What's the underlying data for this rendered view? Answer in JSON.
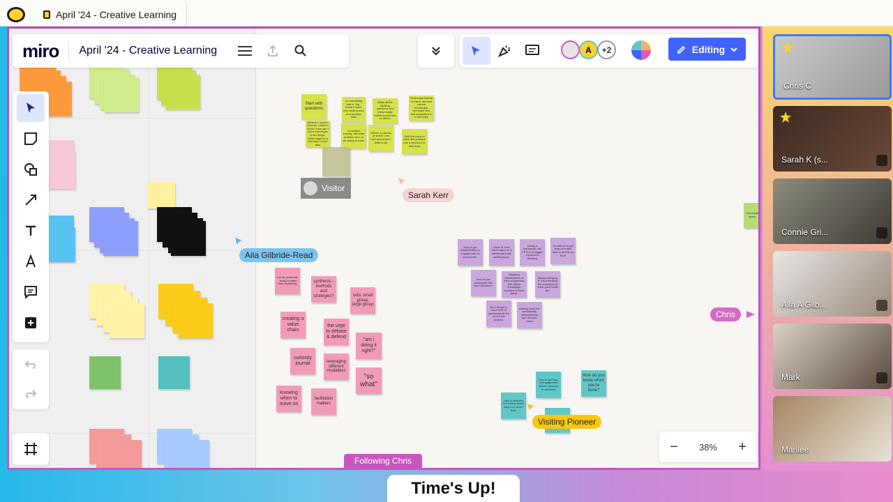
{
  "window": {
    "tab_title": "April '24 - Creative Learning"
  },
  "header": {
    "logo": "miro",
    "board_title": "April '24 - Creative Learning"
  },
  "collab": {
    "avatar_initial": "A",
    "more_count": "+2",
    "editing_label": "Editing"
  },
  "cursors": {
    "sarah": "Sarah Kerr",
    "aila": "Aila Gilbride-Read",
    "chris": "Chris",
    "visitor": "Visitor",
    "visiting_pioneer": "Visiting Pioneer"
  },
  "notes": {
    "yellow": [
      "Start with questions",
      "It's everything that is \"big\", break it down into small pieces and practice each",
      "Make all the thinking questions and ideas easily visible to self and to others",
      "Draft experiments to frame and test current knowledge, threshold and skill acquisition in a new way",
      "What do I know? what do I want to know? How can I know that might, know things. What might be a first step I could take",
      "If problem solving, ask what problem am I or we trying to solve",
      "Sketch a cartoon of where I am now and where I want to be",
      "Shift the need to solve the problem into a structure to help think"
    ],
    "pink": [
      "not the preamble - doing is better than explaining",
      "synthesis - methods and strategies?",
      "solo, small group, large group",
      "creating a value chain",
      "the urge to debate & defend",
      "\"am i doing it right?\"",
      "curiosity journal",
      "leveraging different modalities",
      "\"so what\"",
      "knowing when to move on",
      "facilitation matters"
    ],
    "purple": [
      "How to get stakeholders to engage with us around this.",
      "Place in mine mind maps on a whiteboard with small groups.",
      "Using a framework, the FPTLS to trigger expansive thinking",
      "So difficult to get team to make time to do this up front",
      "How do we distinguish this from research?",
      "Mapping stakeholders or their uniqueness that define knowledge domains to think about.",
      "Always bringing in mind thinking the examples of 'what good looks like'",
      "Don't forget to leave time to synthesize at the end of the session.",
      "Already book the and identify ambivalences and 'second' views"
    ],
    "teal": [
      "How to get buy-in/engagement without jumping to solutions",
      "How do you know when you're done?",
      "How to address the feeling that it takes too much time",
      "How to"
    ],
    "edge_note": "How build opera"
  },
  "toolbar": {
    "zoom_level": "38%",
    "zoom_out": "−",
    "zoom_in": "+"
  },
  "following_label": "Following Chris",
  "participants": [
    {
      "name": "Chris C"
    },
    {
      "name": "Sarah K (s..."
    },
    {
      "name": "Connie Gri..."
    },
    {
      "name": "Aila A Gilb..."
    },
    {
      "name": "Mark"
    },
    {
      "name": "Marilee"
    }
  ],
  "banner": "Time's Up!",
  "colors": {
    "accent": "#4262ff",
    "frame": "#c856c0",
    "yellow_note": "#d6e24a",
    "pink_note": "#f29bb6",
    "purple_note": "#c9a6dd",
    "teal_note": "#5fc7c9"
  }
}
